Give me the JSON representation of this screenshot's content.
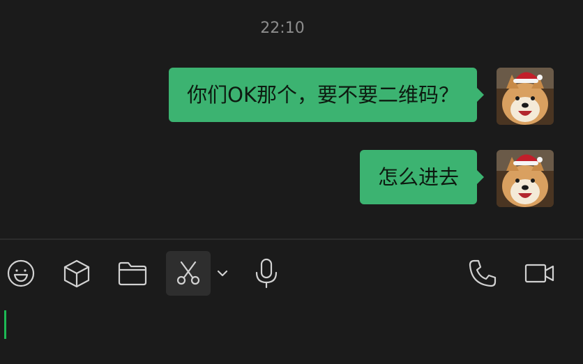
{
  "chat": {
    "timestamp": "22:10",
    "messages": [
      {
        "text": "你们OK那个，要不要二维码？",
        "sender": "me"
      },
      {
        "text": "怎么进去",
        "sender": "me"
      }
    ]
  },
  "toolbar": {
    "left_tools": [
      "emoji-icon",
      "box-icon",
      "folder-icon",
      "scissors-icon",
      "chevron-down-icon",
      "microphone-icon"
    ],
    "right_tools": [
      "phone-icon",
      "video-camera-icon"
    ],
    "active_tool": "scissors-icon"
  },
  "input": {
    "value": ""
  },
  "colors": {
    "background": "#1b1b1b",
    "bubble": "#3cb371",
    "cursor": "#1db954",
    "timestamp": "#8d8d8d",
    "icon": "#d2d2d2"
  }
}
